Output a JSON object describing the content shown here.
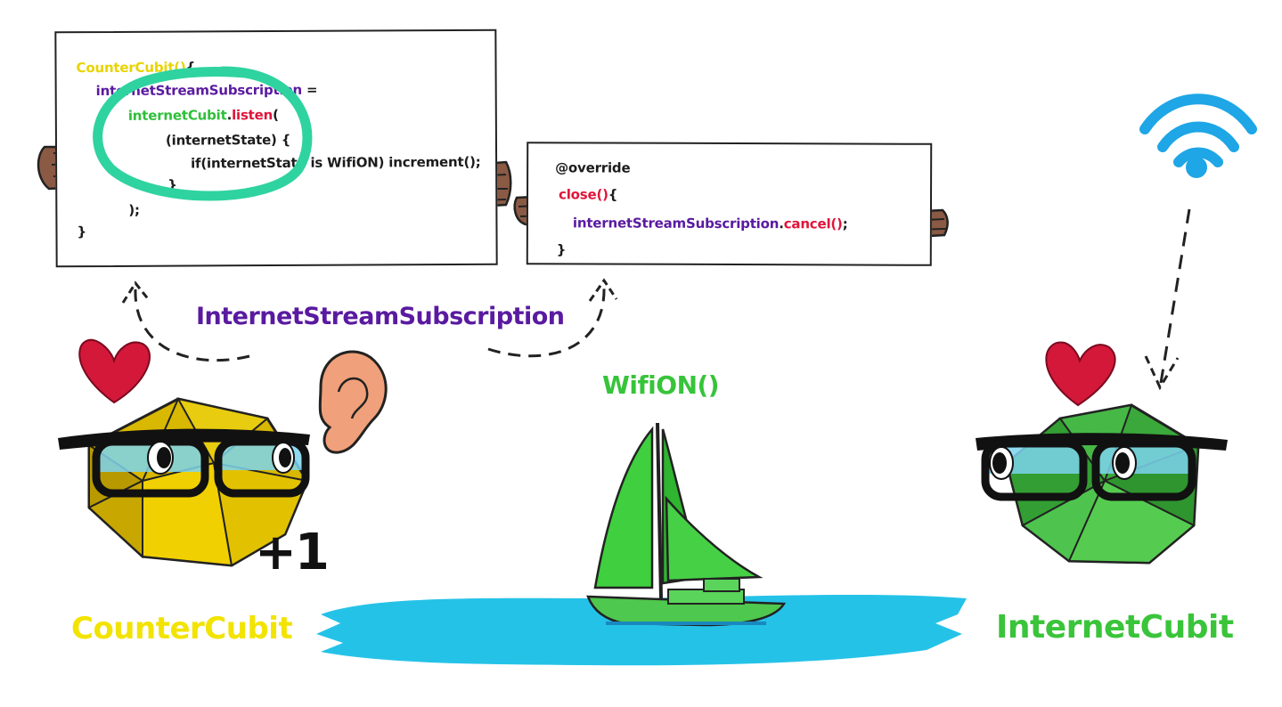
{
  "left_board": {
    "lines": [
      {
        "parts": [
          {
            "t": "CounterCubit()",
            "c": "kw-yellow"
          },
          {
            "t": "{",
            "c": "kw-dark"
          }
        ]
      },
      {
        "parts": [
          {
            "t": "internetStreamSubscription",
            "c": "kw-purple"
          },
          {
            "t": " =",
            "c": "kw-dark"
          }
        ]
      },
      {
        "parts": [
          {
            "t": "internetCubit",
            "c": "kw-green"
          },
          {
            "t": ".",
            "c": "kw-dark"
          },
          {
            "t": "listen",
            "c": "kw-red"
          },
          {
            "t": "(",
            "c": "kw-dark"
          }
        ]
      },
      {
        "parts": [
          {
            "t": "(internetState) {",
            "c": "kw-dark"
          }
        ]
      },
      {
        "parts": [
          {
            "t": "if(internetState is WifiON) increment();",
            "c": "kw-dark"
          }
        ]
      },
      {
        "parts": [
          {
            "t": "}",
            "c": "kw-dark"
          }
        ]
      },
      {
        "parts": [
          {
            "t": ");",
            "c": "kw-dark"
          }
        ]
      },
      {
        "parts": [
          {
            "t": "}",
            "c": "kw-dark"
          }
        ]
      }
    ]
  },
  "right_board": {
    "lines": [
      {
        "parts": [
          {
            "t": "@override",
            "c": "kw-dark"
          }
        ]
      },
      {
        "parts": [
          {
            "t": "close()",
            "c": "kw-red"
          },
          {
            "t": "{",
            "c": "kw-dark"
          }
        ]
      },
      {
        "parts": [
          {
            "t": "internetStreamSubscription",
            "c": "kw-purple"
          },
          {
            "t": ".",
            "c": "kw-dark"
          },
          {
            "t": "cancel()",
            "c": "kw-red"
          },
          {
            "t": ";",
            "c": "kw-dark"
          }
        ]
      },
      {
        "parts": [
          {
            "t": "}",
            "c": "kw-dark"
          }
        ]
      }
    ]
  },
  "labels": {
    "subscription": "InternetStreamSubscription",
    "wifion": "WifiON()",
    "counter": "CounterCubit",
    "internet": "InternetCubit",
    "plus_one": "+1"
  },
  "colors": {
    "yellow_cubit": "#d8b800",
    "green_cubit": "#3aa83a",
    "wifi_blue": "#1ea6e6",
    "water": "#25c2e8",
    "heart": "#d4183a",
    "highlight_circle": "#2fd3a0"
  },
  "icons": [
    "wifi-icon",
    "heart-icon",
    "ear-icon",
    "sailboat-icon",
    "hand-icon"
  ]
}
